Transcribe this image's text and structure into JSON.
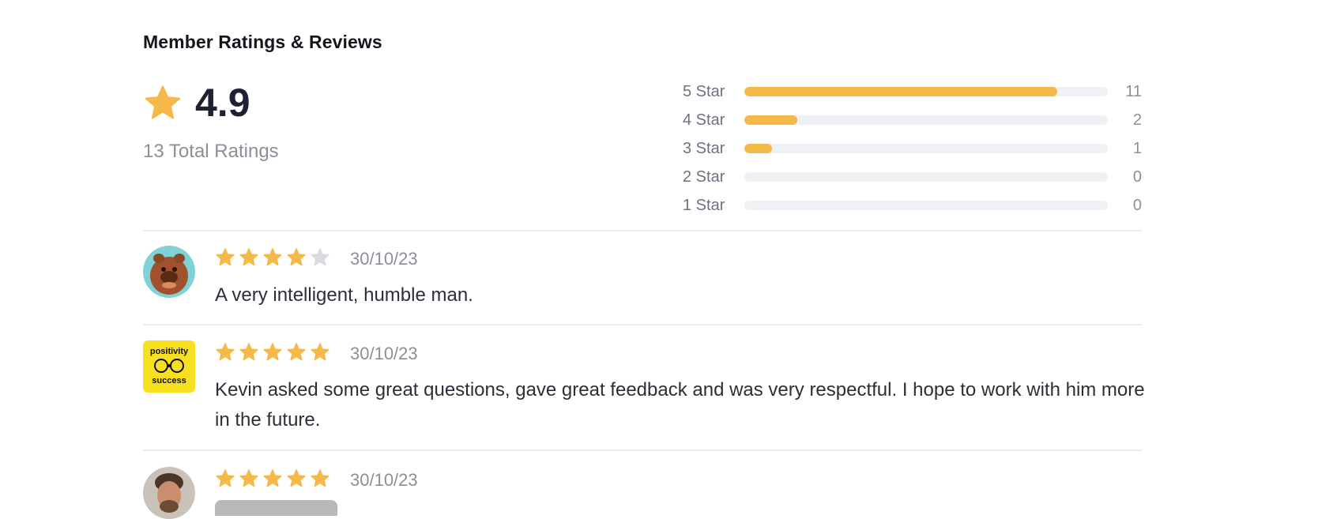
{
  "section_title": "Member Ratings & Reviews",
  "overall": {
    "average": "4.9",
    "total_label": "13 Total Ratings",
    "icon": "star-icon"
  },
  "distribution": [
    {
      "label": "5 Star",
      "count": "11",
      "fraction": 0.86
    },
    {
      "label": "4 Star",
      "count": "2",
      "fraction": 0.145
    },
    {
      "label": "3 Star",
      "count": "1",
      "fraction": 0.075
    },
    {
      "label": "2 Star",
      "count": "0",
      "fraction": 0
    },
    {
      "label": "1 Star",
      "count": "0",
      "fraction": 0
    }
  ],
  "reviews": [
    {
      "rating": 4,
      "date": "30/10/23",
      "text": "A very intelligent, humble man.",
      "avatar": "alf-avatar"
    },
    {
      "rating": 5,
      "date": "30/10/23",
      "text": "Kevin asked some great questions, gave great feedback and was very respectful. I hope to work with him more in the future.",
      "avatar": "positivity-success-logo",
      "avatar_text_top": "positivity",
      "avatar_text_bottom": "success"
    },
    {
      "rating": 5,
      "date": "30/10/23",
      "text": "",
      "avatar": "man-photo-avatar"
    }
  ],
  "colors": {
    "star_filled": "#f5b94a",
    "star_empty": "#d9dbe1",
    "bar_fill": "#f5b94a",
    "bar_track": "#f0f1f4"
  }
}
